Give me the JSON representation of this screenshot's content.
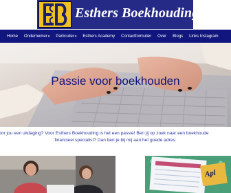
{
  "brand": {
    "name": "Esthers Boekhouding",
    "logo_icon": "eb-monogram-logo",
    "colors": {
      "header_blue": "#262a87",
      "nav_blue": "#10167d",
      "logo_gold": "#f1c21f",
      "text_blue": "#2a31a3"
    }
  },
  "nav": {
    "items": [
      {
        "label": "Home",
        "has_dropdown": false
      },
      {
        "label": "Ondernemer",
        "has_dropdown": true
      },
      {
        "label": "Particulier",
        "has_dropdown": true
      },
      {
        "label": "Esthers Academy",
        "has_dropdown": false
      },
      {
        "label": "Contactformulier",
        "has_dropdown": false
      },
      {
        "label": "Over",
        "has_dropdown": false
      },
      {
        "label": "Blogs",
        "has_dropdown": false
      },
      {
        "label": "Links Instagram",
        "has_dropdown": false
      }
    ],
    "dropdown_icon": "chevron-down-icon"
  },
  "hero": {
    "title": "Passie voor boekhouden",
    "image": "hands-typing-on-laptop-photo"
  },
  "intro": {
    "line1": "oekhouden voor jou een uitdaging? Voor Esthers Boekhouding is het een passie! Ben jij op zoek naar een boekhoude",
    "line2": "financieel specialist? Dan ben je bij mij aan het goede adres."
  },
  "images": {
    "left": "two-women-at-desk-photo",
    "right": "tax-form-photo",
    "right_badge": "Apl"
  }
}
